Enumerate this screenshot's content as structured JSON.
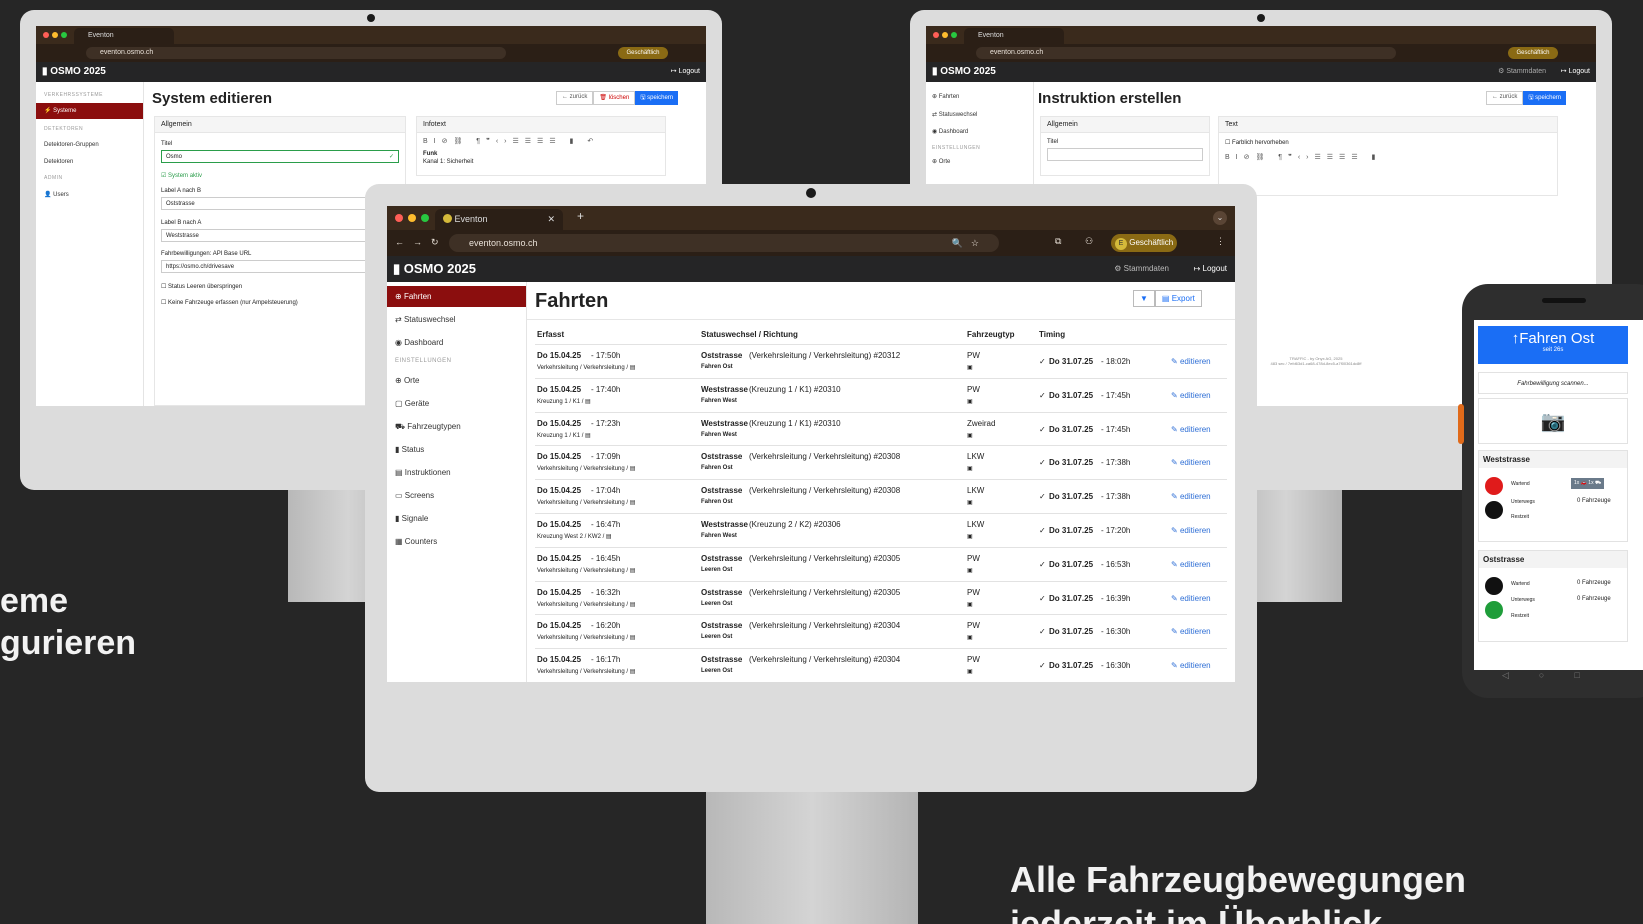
{
  "promo": {
    "left_line1": "eme",
    "left_line2": "gurieren",
    "right_line1": "Alle Fahrzeugbewegungen",
    "right_line2": "jederzeit im Überblick"
  },
  "browser": {
    "tab_title": "Eventon",
    "tab_plus": "+",
    "url": "eventon.osmo.ch",
    "profile": "Geschäftlich",
    "profile_initial": "E"
  },
  "app": {
    "brand": "OSMO 2025",
    "stammdaten": "Stammdaten",
    "logout": "Logout"
  },
  "left_monitor": {
    "page_title": "System editieren",
    "btn_back": "zurück",
    "btn_delete": "löschen",
    "btn_save": "speichern",
    "sidebar": {
      "group1": "VERKEHRSSYSTEME",
      "systeme": "Systeme",
      "group2": "DETEKTOREN",
      "detektoren_gruppen": "Detektoren-Gruppen",
      "detektoren": "Detektoren",
      "group3": "ADMIN",
      "users": "Users"
    },
    "card_allgemein": "Allgemein",
    "label_titel": "Titel",
    "value_titel": "Osmo",
    "system_aktiv": "System aktiv",
    "label_a_b": "Label A nach B",
    "value_a_b": "Oststrasse",
    "label_b_a": "Label B nach A",
    "value_b_a": "Weststrasse",
    "label_api": "Fahrbewilligungen: API Base URL",
    "value_api": "https://osmo.ch/drivesave",
    "check1": "Status Leeren überspringen",
    "check2": "Keine Fahrzeuge erfassen (nur Ampelsteuerung)",
    "card_infotext": "Infotext",
    "info_line1": "Funk",
    "info_line2": "Kanal 1: Sicherheit"
  },
  "right_monitor": {
    "page_title": "Instruktion erstellen",
    "btn_back": "zurück",
    "btn_save": "speichern",
    "sidebar": {
      "fahrten": "Fahrten",
      "statuswechsel": "Statuswechsel",
      "dashboard": "Dashboard",
      "group": "EINSTELLUNGEN",
      "orte": "Orte"
    },
    "card_allgemein": "Allgemein",
    "label_titel": "Titel",
    "card_text": "Text",
    "farblich": "Farblich hervorheben",
    "footer1": "TRAFFIC - by Onyx AG, 2025",
    "footer2": "483 sec / 7efd63d1-ca68-478d-8ec5-a7f00361dc8ff"
  },
  "center_monitor": {
    "page_title": "Fahrten",
    "btn_export": "Export",
    "sidebar": {
      "fahrten": "Fahrten",
      "statuswechsel": "Statuswechsel",
      "dashboard": "Dashboard",
      "group": "EINSTELLUNGEN",
      "orte": "Orte",
      "geraete": "Geräte",
      "fahrzeugtypen": "Fahrzeugtypen",
      "status": "Status",
      "instruktionen": "Instruktionen",
      "screens": "Screens",
      "signale": "Signale",
      "counters": "Counters"
    },
    "columns": [
      "Erfasst",
      "Statuswechsel / Richtung",
      "Fahrzeugtyp",
      "Timing"
    ],
    "rows": [
      {
        "date": "Do 15.04.25",
        "time": " - 17:50h",
        "sub": "Verkehrsleitung / Verkehrsleitung / ▤",
        "street": "Oststrasse",
        "dir": " (Verkehrsleitung / Verkehrsleitung) #20312",
        "status": "Fahren Ost",
        "type": "PW",
        "timing_date": "Do 31.07.25",
        "timing_time": " - 18:02h",
        "edit": "editieren"
      },
      {
        "date": "Do 15.04.25",
        "time": " - 17:40h",
        "sub": "Kreuzung 1 / K1  / ▤",
        "street": "Weststrasse",
        "dir": " (Kreuzung 1 / K1) #20310",
        "status": "Fahren West",
        "type": "PW",
        "timing_date": "Do 31.07.25",
        "timing_time": " - 17:45h",
        "edit": "editieren"
      },
      {
        "date": "Do 15.04.25",
        "time": " - 17:23h",
        "sub": "Kreuzung 1 / K1  / ▤",
        "street": "Weststrasse",
        "dir": " (Kreuzung 1 / K1) #20310",
        "status": "Fahren West",
        "type": "Zweirad",
        "timing_date": "Do 31.07.25",
        "timing_time": " - 17:45h",
        "edit": "editieren"
      },
      {
        "date": "Do 15.04.25",
        "time": " - 17:09h",
        "sub": "Verkehrsleitung / Verkehrsleitung / ▤",
        "street": "Oststrasse",
        "dir": " (Verkehrsleitung / Verkehrsleitung) #20308",
        "status": "Fahren Ost",
        "type": "LKW",
        "timing_date": "Do 31.07.25",
        "timing_time": " - 17:38h",
        "edit": "editieren"
      },
      {
        "date": "Do 15.04.25",
        "time": " - 17:04h",
        "sub": "Verkehrsleitung / Verkehrsleitung / ▤",
        "street": "Oststrasse",
        "dir": " (Verkehrsleitung / Verkehrsleitung) #20308",
        "status": "Fahren Ost",
        "type": "LKW",
        "timing_date": "Do 31.07.25",
        "timing_time": " - 17:38h",
        "edit": "editieren"
      },
      {
        "date": "Do 15.04.25",
        "time": " - 16:47h",
        "sub": "Kreuzung West 2 / KW2 / ▤",
        "street": "Weststrasse",
        "dir": " (Kreuzung 2 / K2) #20306",
        "status": "Fahren West",
        "type": "LKW",
        "timing_date": "Do 31.07.25",
        "timing_time": " - 17:20h",
        "edit": "editieren"
      },
      {
        "date": "Do 15.04.25",
        "time": " - 16:45h",
        "sub": "Verkehrsleitung / Verkehrsleitung / ▤",
        "street": "Oststrasse",
        "dir": " (Verkehrsleitung / Verkehrsleitung) #20305",
        "status": "Leeren Ost",
        "type": "PW",
        "timing_date": "Do 31.07.25",
        "timing_time": " - 16:53h",
        "edit": "editieren"
      },
      {
        "date": "Do 15.04.25",
        "time": " - 16:32h",
        "sub": "Verkehrsleitung / Verkehrsleitung / ▤",
        "street": "Oststrasse",
        "dir": " (Verkehrsleitung / Verkehrsleitung) #20305",
        "status": "Leeren Ost",
        "type": "PW",
        "timing_date": "Do 31.07.25",
        "timing_time": " - 16:39h",
        "edit": "editieren"
      },
      {
        "date": "Do 15.04.25",
        "time": " - 16:20h",
        "sub": "Verkehrsleitung / Verkehrsleitung / ▤",
        "street": "Oststrasse",
        "dir": " (Verkehrsleitung / Verkehrsleitung) #20304",
        "status": "Leeren Ost",
        "type": "PW",
        "timing_date": "Do 31.07.25",
        "timing_time": " - 16:30h",
        "edit": "editieren"
      },
      {
        "date": "Do 15.04.25",
        "time": " - 16:17h",
        "sub": "Verkehrsleitung / Verkehrsleitung / ▤",
        "street": "Oststrasse",
        "dir": " (Verkehrsleitung / Verkehrsleitung) #20304",
        "status": "Leeren Ost",
        "type": "PW",
        "timing_date": "Do 31.07.25",
        "timing_time": " - 16:30h",
        "edit": "editieren"
      }
    ]
  },
  "phone": {
    "header_title": "Fahren Ost",
    "header_sub": "seit 26s",
    "scan_text": "Fahrbewilligung scannen...",
    "west_title": "Weststrasse",
    "west_wartend": "Wartend",
    "west_unterwegs": "Unterwegs",
    "west_restzeit": "Restzeit",
    "west_badge": "1x 🚗 1x ⛟",
    "west_count": "0 Fahrzeuge",
    "ost_title": "Oststrasse",
    "ost_wartend": "Wartend",
    "ost_unterwegs": "Unterwegs",
    "ost_restzeit": "Restzeit",
    "ost_count1": "0 Fahrzeuge",
    "ost_count2": "0 Fahrzeuge",
    "colors": {
      "red": "#e01b1b",
      "black": "#111111",
      "green": "#1f9d3a",
      "blue": "#1a6ef5"
    }
  }
}
